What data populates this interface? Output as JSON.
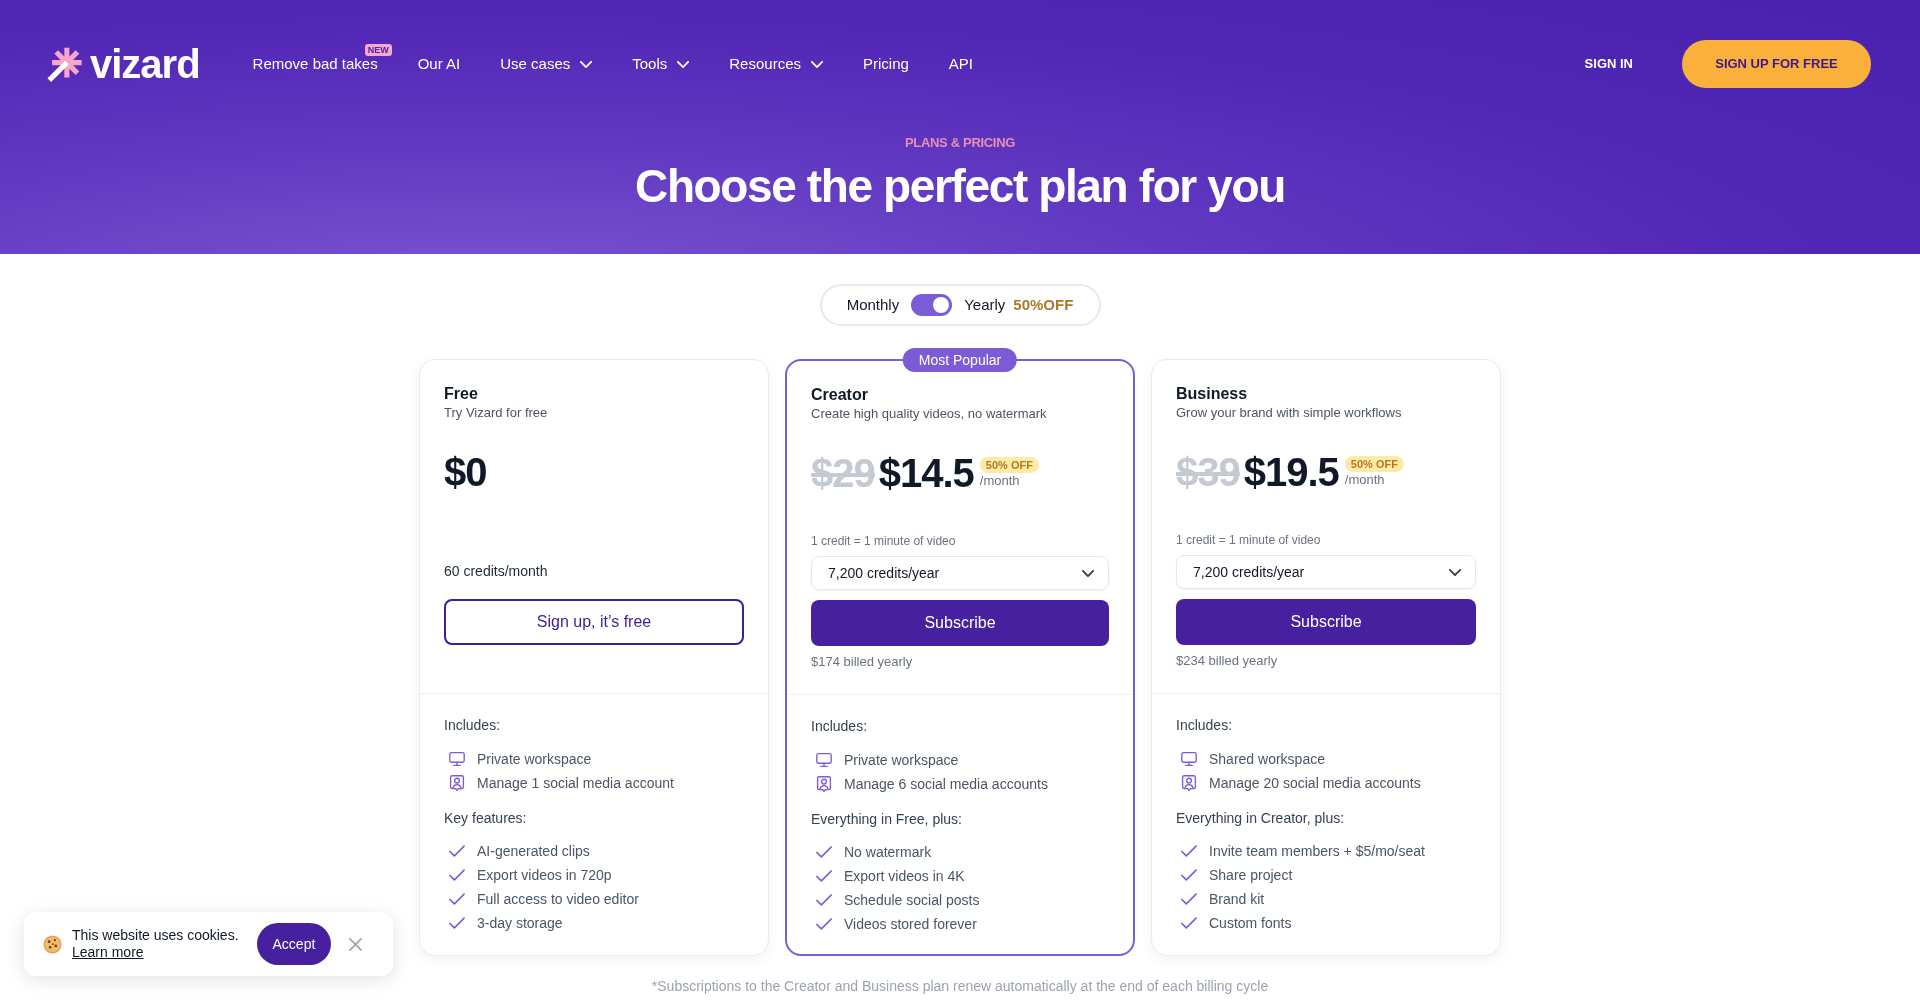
{
  "nav": {
    "logo": "vizard",
    "items": [
      {
        "label": "Remove bad takes",
        "badge": "NEW",
        "dropdown": false
      },
      {
        "label": "Our AI",
        "dropdown": false
      },
      {
        "label": "Use cases",
        "dropdown": true
      },
      {
        "label": "Tools",
        "dropdown": true
      },
      {
        "label": "Resources",
        "dropdown": true
      },
      {
        "label": "Pricing",
        "dropdown": false
      },
      {
        "label": "API",
        "dropdown": false
      }
    ],
    "sign_in": "SIGN IN",
    "sign_up": "SIGN UP FOR FREE"
  },
  "hero": {
    "eyebrow": "PLANS & PRICING",
    "title": "Choose the perfect plan for you"
  },
  "billing_toggle": {
    "monthly": "Monthly",
    "yearly": "Yearly",
    "on": true,
    "discount": "50%OFF"
  },
  "plans": [
    {
      "kind": "outline",
      "name": "Free",
      "tagline": "Try Vizard for free",
      "popular": false,
      "price": "$0",
      "credits": "60 credits/month",
      "button": "Sign up, it’s free",
      "includes_title": "Includes:",
      "includes": [
        {
          "kind": "workspace",
          "text": "Private workspace"
        },
        {
          "kind": "accounts",
          "text": "Manage 1 social media account"
        }
      ],
      "features_title": "Key features:",
      "features": [
        "AI-generated clips",
        "Export videos in 720p",
        "Full access to video editor",
        "3-day storage"
      ]
    },
    {
      "kind": "solid",
      "name": "Creator",
      "tagline": "Create high quality videos, no watermark",
      "popular": true,
      "badge": "Most Popular",
      "old_price": "$29",
      "price": "$14.5",
      "discount": "50% OFF",
      "period": "/month",
      "credit_note": "1 credit = 1 minute of video",
      "credit_select": "7,200 credits/year",
      "button": "Subscribe",
      "billed": "$174 billed yearly",
      "includes_title": "Includes:",
      "includes": [
        {
          "kind": "workspace",
          "text": "Private workspace"
        },
        {
          "kind": "accounts",
          "text": "Manage 6 social media accounts"
        }
      ],
      "features_title": "Everything in Free, plus:",
      "features": [
        "No watermark",
        "Export videos in 4K",
        "Schedule social posts",
        "Videos stored forever"
      ]
    },
    {
      "kind": "solid",
      "name": "Business",
      "tagline": "Grow your brand with simple workflows",
      "popular": false,
      "old_price": "$39",
      "price": "$19.5",
      "discount": "50% OFF",
      "period": "/month",
      "credit_note": "1 credit = 1 minute of video",
      "credit_select": "7,200 credits/year",
      "button": "Subscribe",
      "billed": "$234 billed yearly",
      "includes_title": "Includes:",
      "includes": [
        {
          "kind": "workspace",
          "text": "Shared workspace"
        },
        {
          "kind": "accounts",
          "text": "Manage 20 social media accounts"
        }
      ],
      "features_title": "Everything in Creator, plus:",
      "features": [
        "Invite team members + $5/mo/seat",
        "Share project",
        "Brand kit",
        "Custom fonts"
      ]
    }
  ],
  "footnote": "*Subscriptions to the Creator and Business plan renew automatically at the end of each billing cycle",
  "cookie_banner": {
    "text": "This website uses cookies.",
    "link": "Learn more",
    "button": "Accept"
  }
}
